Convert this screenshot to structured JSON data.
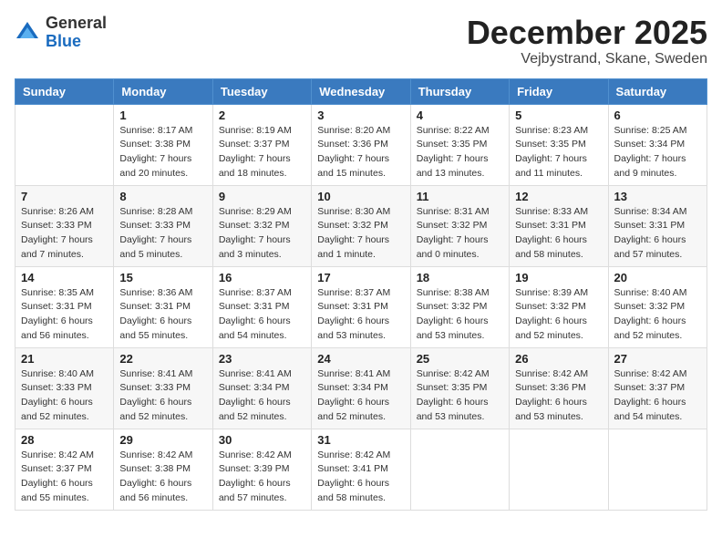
{
  "logo": {
    "general": "General",
    "blue": "Blue"
  },
  "header": {
    "month": "December 2025",
    "location": "Vejbystrand, Skane, Sweden"
  },
  "weekdays": [
    "Sunday",
    "Monday",
    "Tuesday",
    "Wednesday",
    "Thursday",
    "Friday",
    "Saturday"
  ],
  "weeks": [
    [
      {
        "day": "",
        "info": ""
      },
      {
        "day": "1",
        "info": "Sunrise: 8:17 AM\nSunset: 3:38 PM\nDaylight: 7 hours\nand 20 minutes."
      },
      {
        "day": "2",
        "info": "Sunrise: 8:19 AM\nSunset: 3:37 PM\nDaylight: 7 hours\nand 18 minutes."
      },
      {
        "day": "3",
        "info": "Sunrise: 8:20 AM\nSunset: 3:36 PM\nDaylight: 7 hours\nand 15 minutes."
      },
      {
        "day": "4",
        "info": "Sunrise: 8:22 AM\nSunset: 3:35 PM\nDaylight: 7 hours\nand 13 minutes."
      },
      {
        "day": "5",
        "info": "Sunrise: 8:23 AM\nSunset: 3:35 PM\nDaylight: 7 hours\nand 11 minutes."
      },
      {
        "day": "6",
        "info": "Sunrise: 8:25 AM\nSunset: 3:34 PM\nDaylight: 7 hours\nand 9 minutes."
      }
    ],
    [
      {
        "day": "7",
        "info": "Sunrise: 8:26 AM\nSunset: 3:33 PM\nDaylight: 7 hours\nand 7 minutes."
      },
      {
        "day": "8",
        "info": "Sunrise: 8:28 AM\nSunset: 3:33 PM\nDaylight: 7 hours\nand 5 minutes."
      },
      {
        "day": "9",
        "info": "Sunrise: 8:29 AM\nSunset: 3:32 PM\nDaylight: 7 hours\nand 3 minutes."
      },
      {
        "day": "10",
        "info": "Sunrise: 8:30 AM\nSunset: 3:32 PM\nDaylight: 7 hours\nand 1 minute."
      },
      {
        "day": "11",
        "info": "Sunrise: 8:31 AM\nSunset: 3:32 PM\nDaylight: 7 hours\nand 0 minutes."
      },
      {
        "day": "12",
        "info": "Sunrise: 8:33 AM\nSunset: 3:31 PM\nDaylight: 6 hours\nand 58 minutes."
      },
      {
        "day": "13",
        "info": "Sunrise: 8:34 AM\nSunset: 3:31 PM\nDaylight: 6 hours\nand 57 minutes."
      }
    ],
    [
      {
        "day": "14",
        "info": "Sunrise: 8:35 AM\nSunset: 3:31 PM\nDaylight: 6 hours\nand 56 minutes."
      },
      {
        "day": "15",
        "info": "Sunrise: 8:36 AM\nSunset: 3:31 PM\nDaylight: 6 hours\nand 55 minutes."
      },
      {
        "day": "16",
        "info": "Sunrise: 8:37 AM\nSunset: 3:31 PM\nDaylight: 6 hours\nand 54 minutes."
      },
      {
        "day": "17",
        "info": "Sunrise: 8:37 AM\nSunset: 3:31 PM\nDaylight: 6 hours\nand 53 minutes."
      },
      {
        "day": "18",
        "info": "Sunrise: 8:38 AM\nSunset: 3:32 PM\nDaylight: 6 hours\nand 53 minutes."
      },
      {
        "day": "19",
        "info": "Sunrise: 8:39 AM\nSunset: 3:32 PM\nDaylight: 6 hours\nand 52 minutes."
      },
      {
        "day": "20",
        "info": "Sunrise: 8:40 AM\nSunset: 3:32 PM\nDaylight: 6 hours\nand 52 minutes."
      }
    ],
    [
      {
        "day": "21",
        "info": "Sunrise: 8:40 AM\nSunset: 3:33 PM\nDaylight: 6 hours\nand 52 minutes."
      },
      {
        "day": "22",
        "info": "Sunrise: 8:41 AM\nSunset: 3:33 PM\nDaylight: 6 hours\nand 52 minutes."
      },
      {
        "day": "23",
        "info": "Sunrise: 8:41 AM\nSunset: 3:34 PM\nDaylight: 6 hours\nand 52 minutes."
      },
      {
        "day": "24",
        "info": "Sunrise: 8:41 AM\nSunset: 3:34 PM\nDaylight: 6 hours\nand 52 minutes."
      },
      {
        "day": "25",
        "info": "Sunrise: 8:42 AM\nSunset: 3:35 PM\nDaylight: 6 hours\nand 53 minutes."
      },
      {
        "day": "26",
        "info": "Sunrise: 8:42 AM\nSunset: 3:36 PM\nDaylight: 6 hours\nand 53 minutes."
      },
      {
        "day": "27",
        "info": "Sunrise: 8:42 AM\nSunset: 3:37 PM\nDaylight: 6 hours\nand 54 minutes."
      }
    ],
    [
      {
        "day": "28",
        "info": "Sunrise: 8:42 AM\nSunset: 3:37 PM\nDaylight: 6 hours\nand 55 minutes."
      },
      {
        "day": "29",
        "info": "Sunrise: 8:42 AM\nSunset: 3:38 PM\nDaylight: 6 hours\nand 56 minutes."
      },
      {
        "day": "30",
        "info": "Sunrise: 8:42 AM\nSunset: 3:39 PM\nDaylight: 6 hours\nand 57 minutes."
      },
      {
        "day": "31",
        "info": "Sunrise: 8:42 AM\nSunset: 3:41 PM\nDaylight: 6 hours\nand 58 minutes."
      },
      {
        "day": "",
        "info": ""
      },
      {
        "day": "",
        "info": ""
      },
      {
        "day": "",
        "info": ""
      }
    ]
  ]
}
